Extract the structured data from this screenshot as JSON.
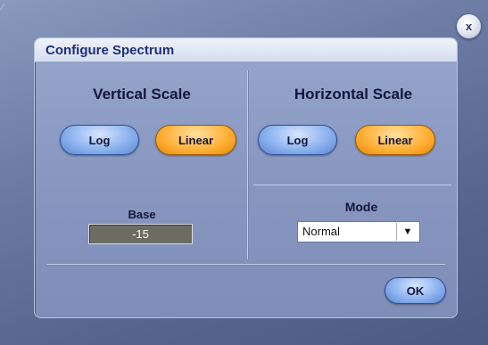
{
  "window": {
    "close_label": "x"
  },
  "dialog": {
    "title": "Configure Spectrum"
  },
  "vertical_scale": {
    "title": "Vertical Scale",
    "log_label": "Log",
    "linear_label": "Linear",
    "selected": "Linear",
    "base_label": "Base",
    "base_value": "-15"
  },
  "horizontal_scale": {
    "title": "Horizontal Scale",
    "log_label": "Log",
    "linear_label": "Linear",
    "selected": "Linear",
    "mode_label": "Mode",
    "mode_value": "Normal"
  },
  "footer": {
    "ok_label": "OK"
  },
  "colors": {
    "selected_button": "#ffb23a",
    "unselected_button": "#8db3ef",
    "title_text": "#1d2f7a",
    "dialog_bg": "#8897c0"
  },
  "icons": {
    "close": "close-icon",
    "dropdown": "chevron-down-icon"
  }
}
